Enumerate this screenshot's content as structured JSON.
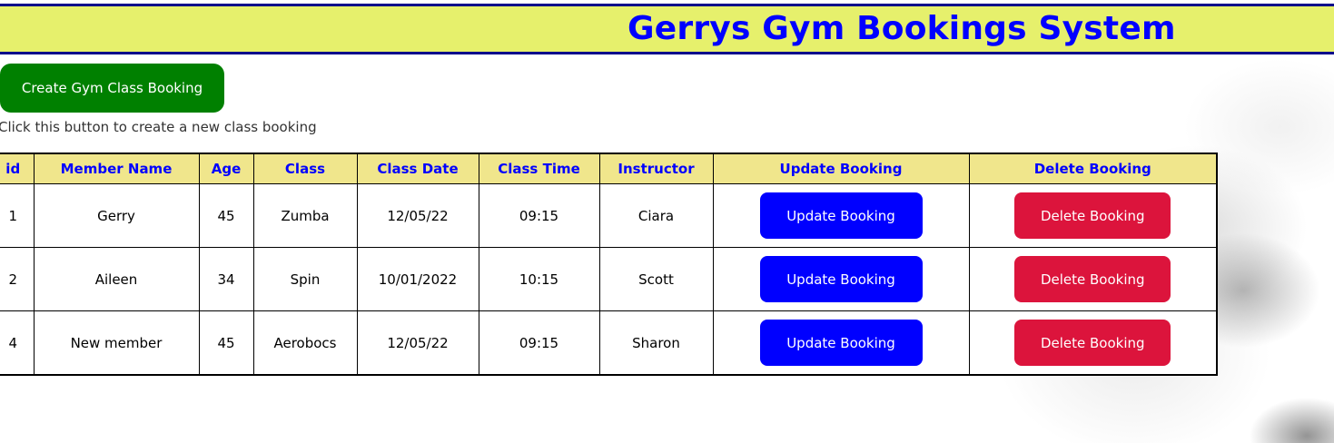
{
  "header": {
    "title": "Gerrys Gym Bookings System"
  },
  "create": {
    "button_label": "Create Gym Class Booking",
    "hint": "Click this button to create a new class booking"
  },
  "table": {
    "columns": [
      "id",
      "Member Name",
      "Age",
      "Class",
      "Class Date",
      "Class Time",
      "Instructor",
      "Update Booking",
      "Delete Booking"
    ],
    "rows": [
      {
        "id": "1",
        "member_name": "Gerry",
        "age": "45",
        "class": "Zumba",
        "class_date": "12/05/22",
        "class_time": "09:15",
        "instructor": "Ciara",
        "update_label": "Update Booking",
        "delete_label": "Delete Booking"
      },
      {
        "id": "2",
        "member_name": "Aileen",
        "age": "34",
        "class": "Spin",
        "class_date": "10/01/2022",
        "class_time": "10:15",
        "instructor": "Scott",
        "update_label": "Update Booking",
        "delete_label": "Delete Booking"
      },
      {
        "id": "4",
        "member_name": "New member",
        "age": "45",
        "class": "Aerobocs",
        "class_date": "12/05/22",
        "class_time": "09:15",
        "instructor": "Sharon",
        "update_label": "Update Booking",
        "delete_label": "Delete Booking"
      }
    ]
  },
  "colors": {
    "header_bg": "#e6f06c",
    "header_border": "#00008b",
    "title": "#0000ff",
    "create_button": "#008000",
    "table_header_bg": "#f0e68c",
    "update_button": "#0000ff",
    "delete_button": "#dc143c"
  }
}
